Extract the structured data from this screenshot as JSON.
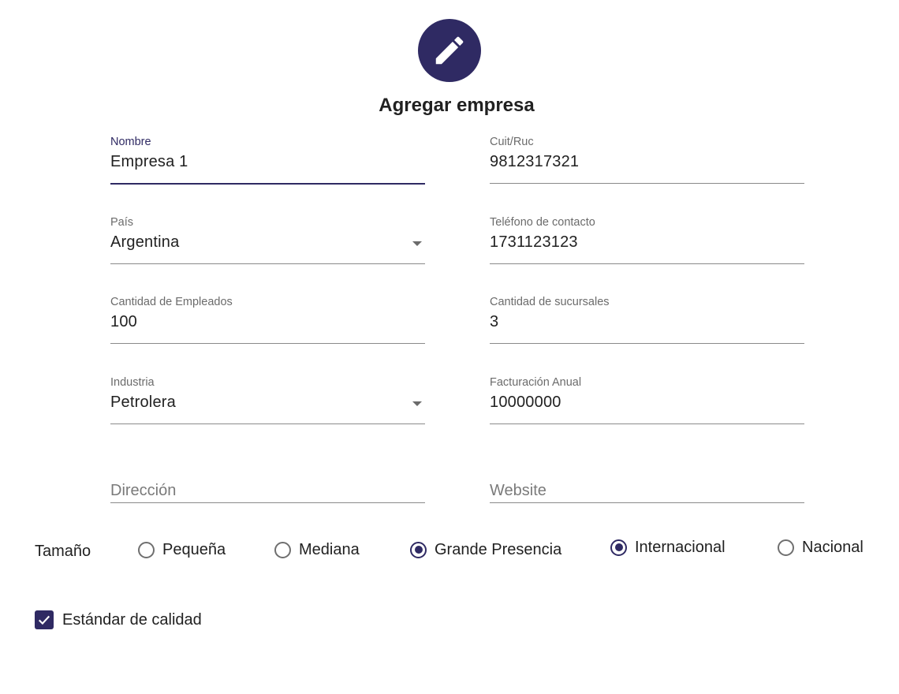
{
  "header": {
    "title": "Agregar empresa",
    "avatar_icon": "pencil-icon",
    "accent_color": "#2f2a63"
  },
  "form": {
    "nombre": {
      "label": "Nombre",
      "value": "Empresa 1"
    },
    "cuit": {
      "label": "Cuit/Ruc",
      "value": "9812317321"
    },
    "pais": {
      "label": "País",
      "value": "Argentina"
    },
    "telefono": {
      "label": "Teléfono de contacto",
      "value": "1731123123"
    },
    "empleados": {
      "label": "Cantidad de Empleados",
      "value": "100"
    },
    "sucursales": {
      "label": "Cantidad de sucursales",
      "value": "3"
    },
    "industria": {
      "label": "Industria",
      "value": "Petrolera"
    },
    "facturacion": {
      "label": "Facturación Anual",
      "value": "10000000"
    },
    "direccion": {
      "placeholder": "Dirección"
    },
    "website": {
      "placeholder": "Website"
    }
  },
  "tamano": {
    "label": "Tamaño",
    "options": [
      {
        "label": "Pequeña",
        "checked": false
      },
      {
        "label": "Mediana",
        "checked": false
      },
      {
        "label": "Grande Presencia",
        "checked": true
      },
      {
        "label": "Internacional",
        "checked": true
      },
      {
        "label": "Nacional",
        "checked": false
      }
    ]
  },
  "calidad": {
    "label": "Estándar de calidad",
    "checked": true
  }
}
